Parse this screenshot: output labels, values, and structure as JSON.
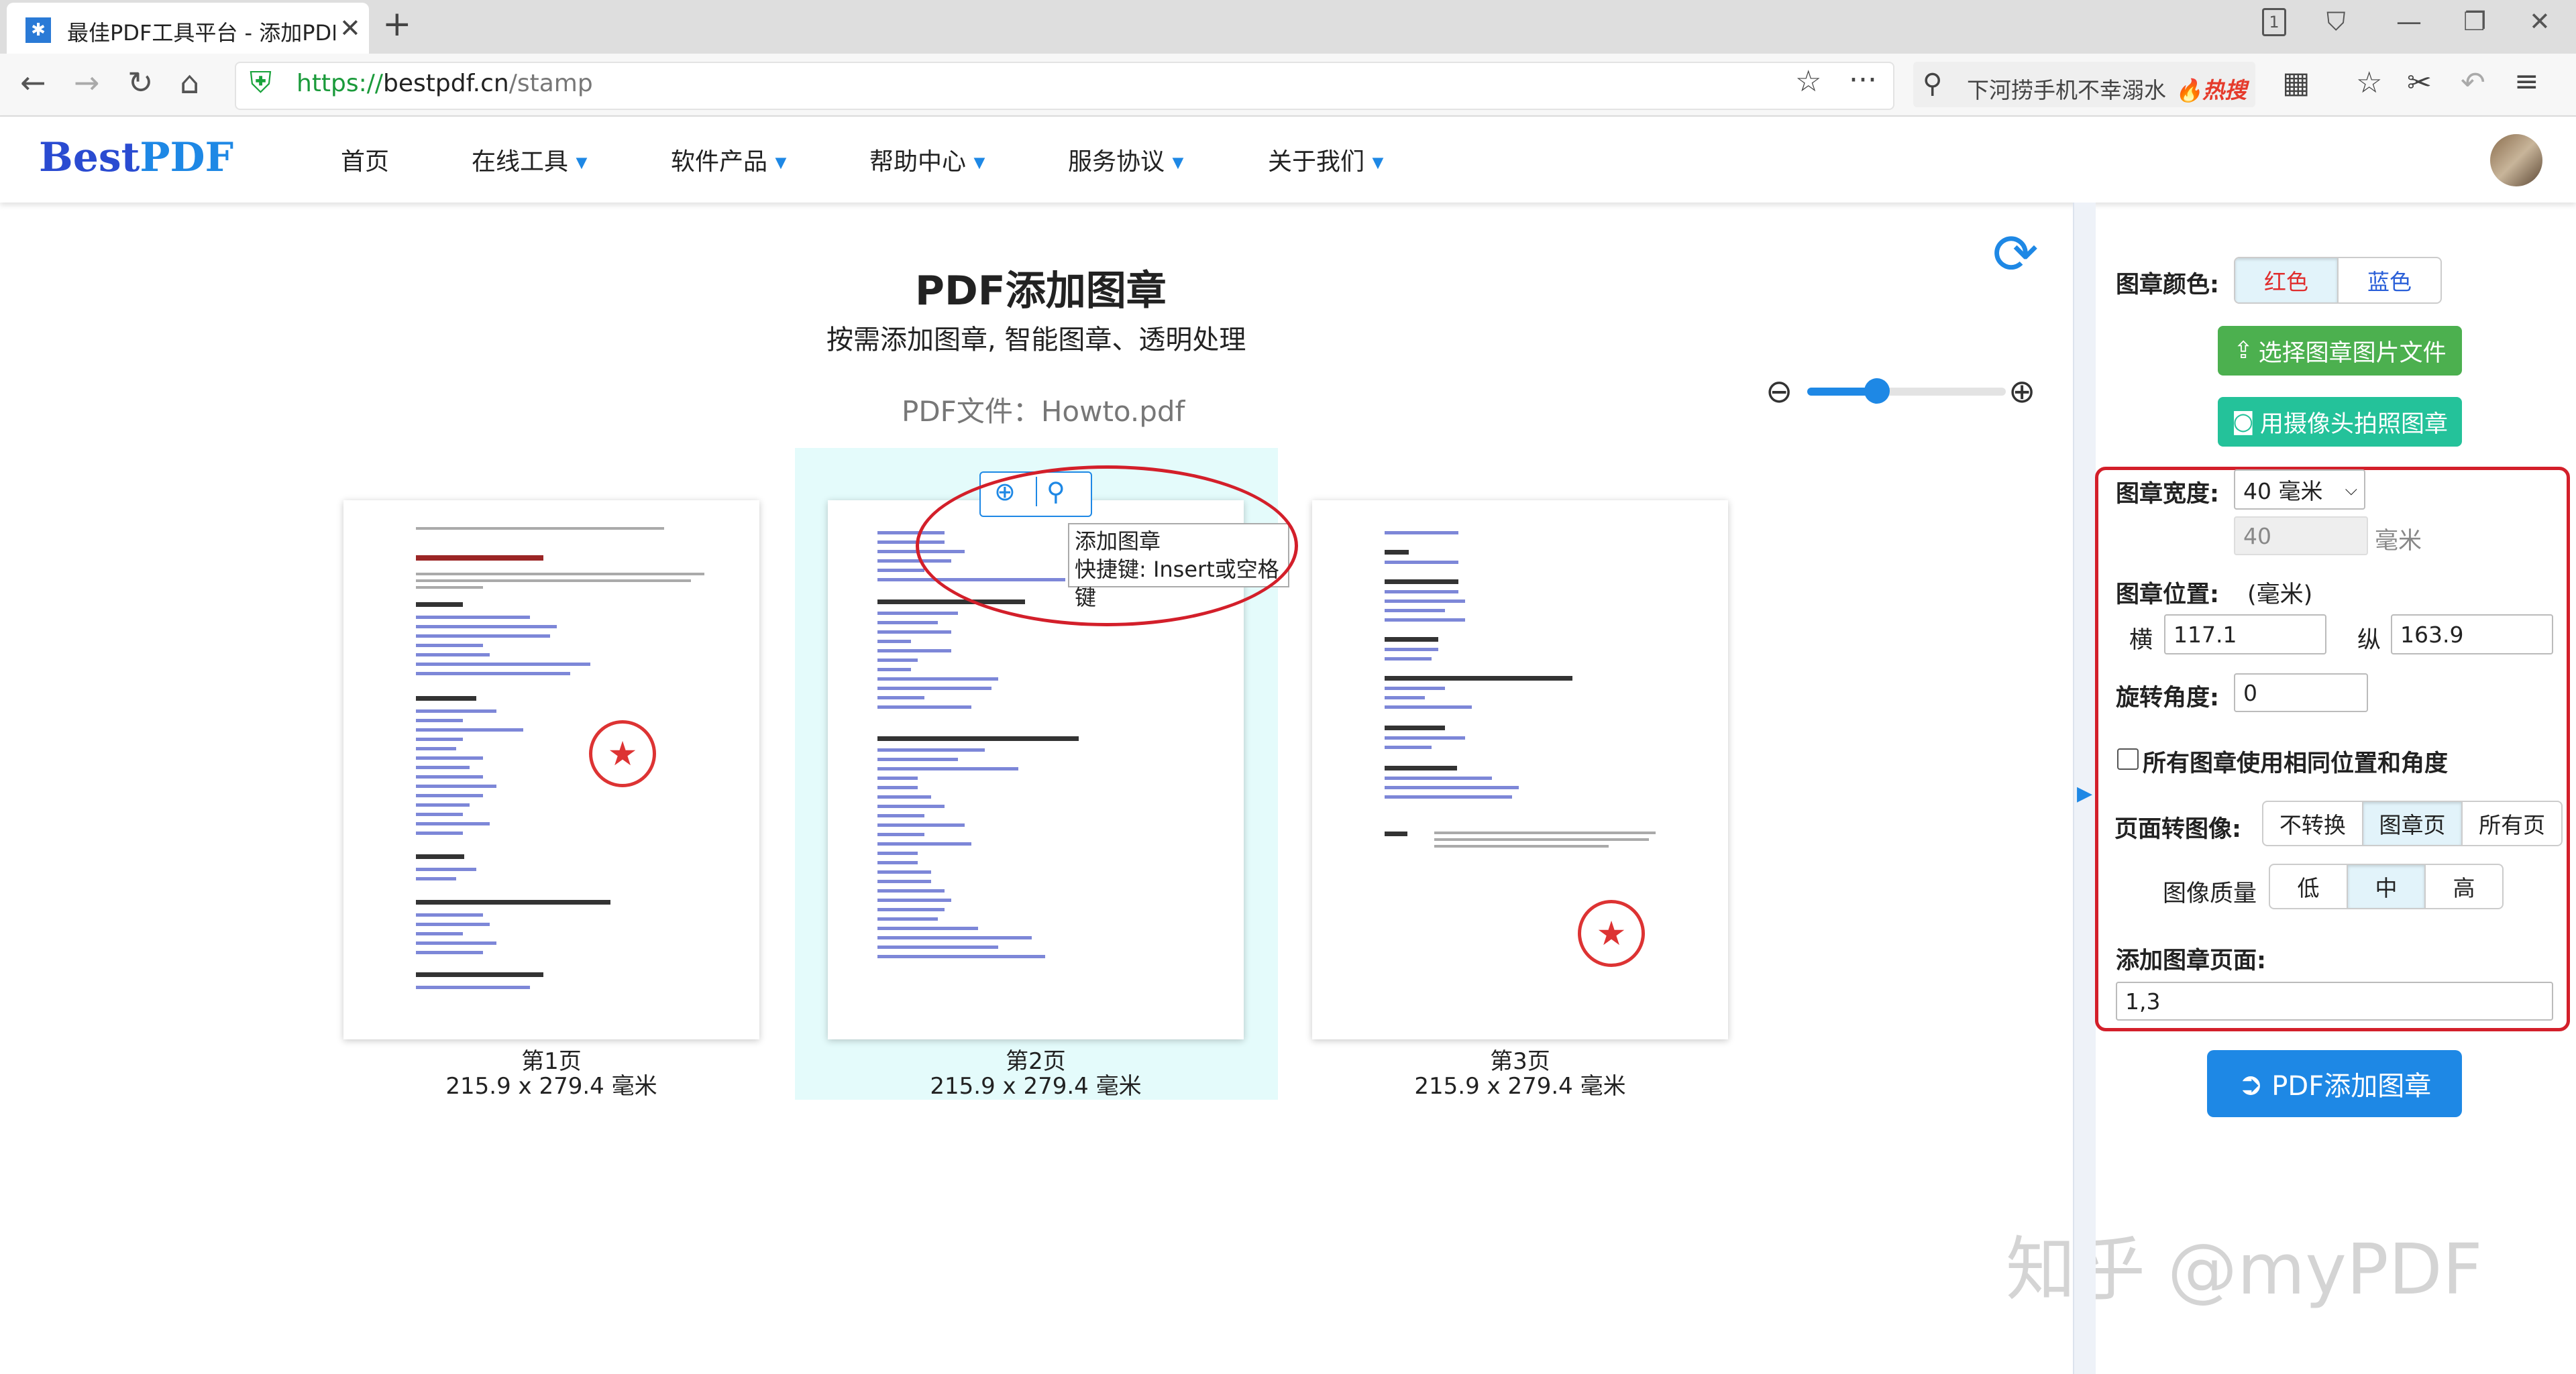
{
  "browser": {
    "tab_title": "最佳PDF工具平台 - 添加PDF图章",
    "url_scheme": "https://",
    "url_host": "bestpdf.cn",
    "url_path": "/stamp",
    "search_placeholder": "下河捞手机不幸溺水",
    "search_hot": "🔥热搜"
  },
  "site": {
    "logo_best": "Best",
    "logo_pdf": "PDF",
    "menu": [
      {
        "label": "首页"
      },
      {
        "label": "在线工具"
      },
      {
        "label": "软件产品"
      },
      {
        "label": "帮助中心"
      },
      {
        "label": "服务协议"
      },
      {
        "label": "关于我们"
      }
    ]
  },
  "main": {
    "title": "PDF添加图章",
    "subtitle": "按需添加图章, 智能图章、透明处理",
    "file_label": "PDF文件：Howto.pdf",
    "zoom_level": 0.35,
    "tooltip_line1": "添加图章",
    "tooltip_line2": "快捷键: Insert或空格键",
    "pages": [
      {
        "label": "第1页",
        "size": "215.9 x 279.4 毫米",
        "has_stamp": true,
        "selected": false
      },
      {
        "label": "第2页",
        "size": "215.9 x 279.4 毫米",
        "has_stamp": false,
        "selected": true
      },
      {
        "label": "第3页",
        "size": "215.9 x 279.4 毫米",
        "has_stamp": true,
        "selected": false
      }
    ],
    "watermark": "知乎 @myPDF"
  },
  "panel": {
    "color_label": "图章颜色:",
    "color_red": "红色",
    "color_blue": "蓝色",
    "select_image_btn": "选择图章图片文件",
    "camera_btn": "用摄像头拍照图章",
    "width_label": "图章宽度:",
    "width_select": "40 毫米",
    "width_value": "40",
    "width_unit": "毫米",
    "position_label": "图章位置:",
    "position_unit": "(毫米)",
    "x_label": "横",
    "x_value": "117.1",
    "y_label": "纵",
    "y_value": "163.9",
    "rotate_label": "旋转角度:",
    "rotate_value": "0",
    "same_pos_label": "所有图章使用相同位置和角度",
    "convert_label": "页面转图像:",
    "convert_options": [
      "不转换",
      "图章页",
      "所有页"
    ],
    "quality_label": "图像质量",
    "quality_options": [
      "低",
      "中",
      "高"
    ],
    "pages_label": "添加图章页面:",
    "pages_value": "1,3",
    "submit_btn": "PDF添加图章"
  }
}
